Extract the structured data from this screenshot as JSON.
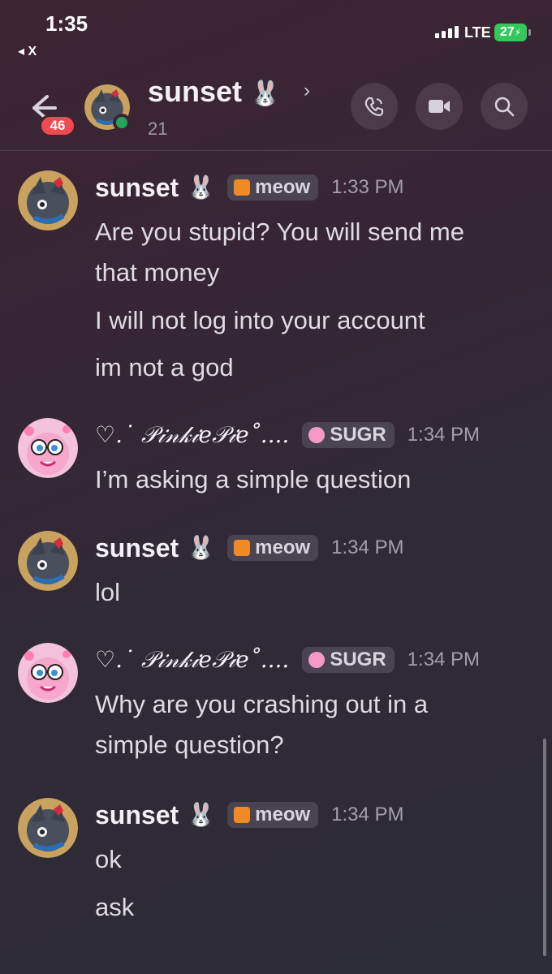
{
  "status_bar": {
    "time": "1:35",
    "back_app": "◂ X",
    "network": "LTE",
    "battery": "27"
  },
  "header": {
    "unread_count": "46",
    "title": "sunset 🐰",
    "member_count": "21",
    "icons": [
      "back-arrow-icon",
      "phone-icon",
      "video-icon",
      "search-icon"
    ]
  },
  "messages": [
    {
      "author": "sunset",
      "tag": "meow",
      "time": "1:33 PM",
      "avatar": "sunset",
      "lines": [
        "Are you stupid? You will send me",
        "that money",
        "I will not log into your account",
        "im not a god"
      ]
    },
    {
      "author": "♡.˙ 𝒫𝒾𝓃𝓀𝒾𝑒𝒫𝒾𝑒˚....",
      "tag": "SUGR",
      "time": "1:34 PM",
      "avatar": "pinkie",
      "lines": [
        "I’m asking a simple question"
      ]
    },
    {
      "author": "sunset",
      "tag": "meow",
      "time": "1:34 PM",
      "avatar": "sunset",
      "lines": [
        "lol"
      ]
    },
    {
      "author": "♡.˙ 𝒫𝒾𝓃𝓀𝒾𝑒𝒫𝒾𝑒˚....",
      "tag": "SUGR",
      "time": "1:34 PM",
      "avatar": "pinkie",
      "lines": [
        "Why are you crashing out in a",
        "simple question?"
      ]
    },
    {
      "author": "sunset",
      "tag": "meow",
      "time": "1:34 PM",
      "avatar": "sunset",
      "lines": [
        "ok",
        "ask"
      ]
    }
  ],
  "colors": {
    "badge": "#ee4a4f",
    "online": "#23a55a",
    "battery": "#34c759"
  }
}
